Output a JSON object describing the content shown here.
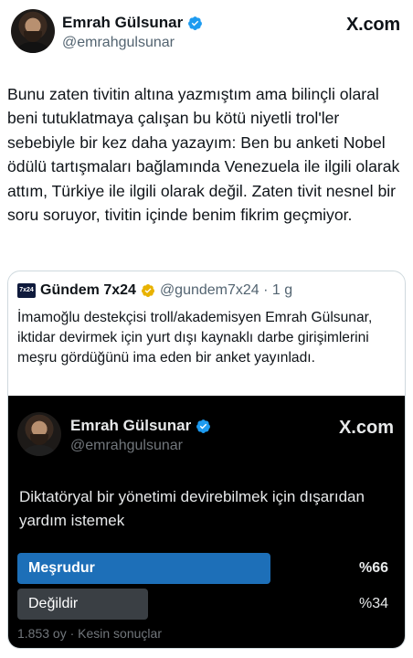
{
  "header": {
    "author_name": "Emrah Gülsunar",
    "author_handle": "@emrahgulsunar",
    "brand": "X.com"
  },
  "tweet": {
    "text": "Bunu zaten tivitin altına yazmıştım ama bilinçli olaral beni tutuklatmaya çalışan bu kötü niyetli trol'ler sebebiyle bir kez daha yazayım: Ben bu anketi Nobel ödülü tartışmaları bağlamında Venezuela ile ilgili olarak attım, Türkiye ile ilgili olarak değil. Zaten tivit nesnel bir soru soruyor, tivitin içinde benim fikrim geçmiyor."
  },
  "quote": {
    "logo_text": "7x24",
    "name": "Gündem 7x24",
    "handle_time": "@gundem7x24 · 1 g",
    "text": "İmamoğlu destekçisi troll/akademisyen Emrah Gülsunar, iktidar devirmek için yurt dışı kaynaklı darbe girişimlerini meşru gördüğünü ima eden bir anket yayınladı.",
    "accent": "#f4b400"
  },
  "poll_card": {
    "author_name": "Emrah Gülsunar",
    "author_handle": "@emrahgulsunar",
    "brand": "X.com",
    "question": "Diktatöryal bir yönetimi devirebilmek için dışarıdan yardım istemek",
    "options": [
      {
        "label": "Meşrudur",
        "percent": "%66",
        "share": 0.66,
        "color": "#1d6fb8"
      },
      {
        "label": "Değildir",
        "percent": "%34",
        "share": 0.34,
        "color": "#3a3f44"
      }
    ],
    "meta": "1.853 oy · Kesin sonuçlar",
    "verified_color": "#1d9bf0"
  }
}
